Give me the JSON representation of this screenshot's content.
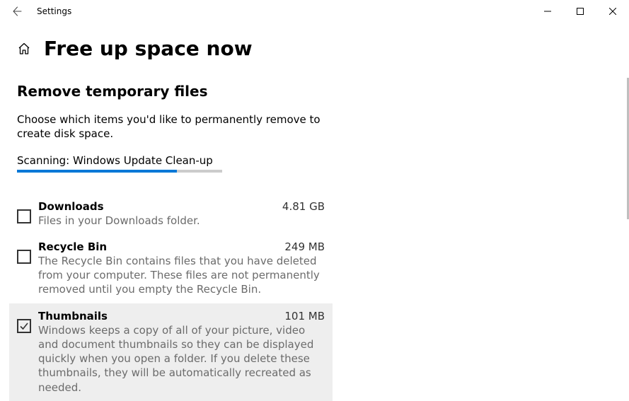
{
  "app": {
    "name": "Settings"
  },
  "page": {
    "title": "Free up space now"
  },
  "section": {
    "title": "Remove temporary files",
    "description": "Choose which items you'd like to permanently remove to create disk space."
  },
  "scan": {
    "status": "Scanning: Windows Update Clean-up",
    "percent": 78
  },
  "items": [
    {
      "title": "Downloads",
      "size": "4.81 GB",
      "description": "Files in your Downloads folder.",
      "checked": false,
      "hover": false
    },
    {
      "title": "Recycle Bin",
      "size": "249 MB",
      "description": "The Recycle Bin contains files that you have deleted from your computer. These files are not permanently removed until you empty the Recycle Bin.",
      "checked": false,
      "hover": false
    },
    {
      "title": "Thumbnails",
      "size": "101 MB",
      "description": "Windows keeps a copy of all of your picture, video and document thumbnails so they can be displayed quickly when you open a folder. If you delete these thumbnails, they will be automatically recreated as needed.",
      "checked": true,
      "hover": true
    }
  ]
}
